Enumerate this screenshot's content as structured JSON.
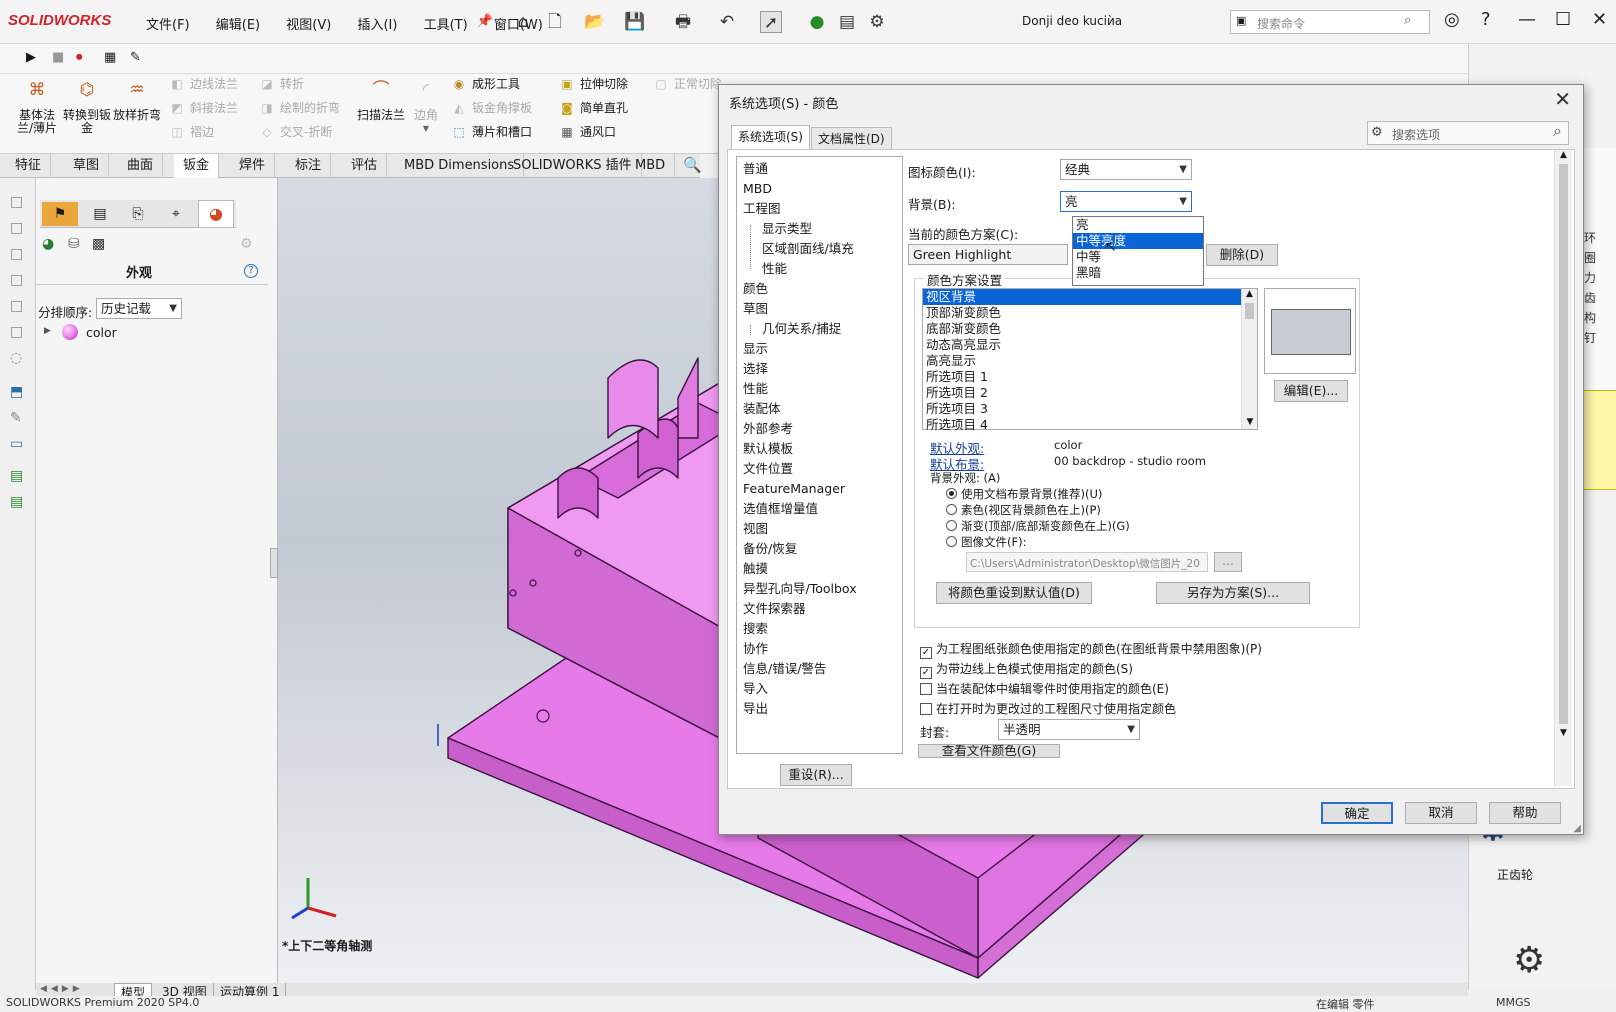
{
  "app": {
    "logo": "SOLIDWORKS",
    "menus": [
      "文件(F)",
      "编辑(E)",
      "视图(V)",
      "插入(I)",
      "工具(T)",
      "窗口(W)"
    ],
    "doc_title": "Donji deo kuciѝa",
    "search_placeholder": "搜索命令"
  },
  "ribbon": {
    "big_buttons": [
      "基体法兰/薄片",
      "转换到钣金",
      "放样折弯",
      "扫描法兰"
    ],
    "small_buttons": [
      {
        "label": "边线法兰",
        "disabled": true
      },
      {
        "label": "转折",
        "disabled": true
      },
      {
        "label": "斜接法兰",
        "disabled": true
      },
      {
        "label": "绘制的折弯",
        "disabled": true
      },
      {
        "label": "褶边",
        "disabled": true
      },
      {
        "label": "交叉-折断",
        "disabled": true
      },
      {
        "label": "边角",
        "disabled": true
      },
      {
        "label": "成形工具",
        "disabled": false
      },
      {
        "label": "钣金角撑板",
        "disabled": true
      },
      {
        "label": "薄片和槽口",
        "disabled": false
      },
      {
        "label": "拉伸切除",
        "disabled": false
      },
      {
        "label": "正常切除",
        "disabled": true
      },
      {
        "label": "简单直孔",
        "disabled": false
      },
      {
        "label": "通风口",
        "disabled": false
      }
    ]
  },
  "command_tabs": [
    "特征",
    "草图",
    "曲面",
    "钣金",
    "焊件",
    "标注",
    "评估",
    "MBD Dimensions",
    "SOLIDWORKS 插件",
    "MBD"
  ],
  "left_panel": {
    "title": "外观",
    "sort_label": "分排顺序:",
    "sort_value": "历史记载",
    "tree_item": "color"
  },
  "viewport": {
    "view_label": "*上下二等角轴测",
    "bottom_tabs": [
      "模型",
      "3D 视图",
      "运动算例 1"
    ],
    "status": "SOLIDWORKS Premium 2020 SP4.0",
    "status_right": "在编辑 零件",
    "units": "MMGS",
    "right_items": [
      "正齿轮"
    ]
  },
  "dialog": {
    "title": "系统选项(S) - 颜色",
    "tabs": [
      "系统选项(S)",
      "文档属性(D)"
    ],
    "search_placeholder": "搜索选项",
    "tree": [
      {
        "label": "普通",
        "sub": false
      },
      {
        "label": "MBD",
        "sub": false
      },
      {
        "label": "工程图",
        "sub": false
      },
      {
        "label": "显示类型",
        "sub": true
      },
      {
        "label": "区域剖面线/填充",
        "sub": true
      },
      {
        "label": "性能",
        "sub": true
      },
      {
        "label": "颜色",
        "sub": false
      },
      {
        "label": "草图",
        "sub": false
      },
      {
        "label": "几何关系/捕捉",
        "sub": true
      },
      {
        "label": "显示",
        "sub": false
      },
      {
        "label": "选择",
        "sub": false
      },
      {
        "label": "性能",
        "sub": false
      },
      {
        "label": "装配体",
        "sub": false
      },
      {
        "label": "外部参考",
        "sub": false
      },
      {
        "label": "默认模板",
        "sub": false
      },
      {
        "label": "文件位置",
        "sub": false
      },
      {
        "label": "FeatureManager",
        "sub": false
      },
      {
        "label": "选值框增量值",
        "sub": false
      },
      {
        "label": "视图",
        "sub": false
      },
      {
        "label": "备份/恢复",
        "sub": false
      },
      {
        "label": "触摸",
        "sub": false
      },
      {
        "label": "异型孔向导/Toolbox",
        "sub": false
      },
      {
        "label": "文件探索器",
        "sub": false
      },
      {
        "label": "搜索",
        "sub": false
      },
      {
        "label": "协作",
        "sub": false
      },
      {
        "label": "信息/错误/警告",
        "sub": false
      },
      {
        "label": "导入",
        "sub": false
      },
      {
        "label": "导出",
        "sub": false
      }
    ],
    "reset_button": "重设(R)...",
    "icon_color_label": "图标颜色(I):",
    "icon_color_value": "经典",
    "background_label": "背景(B):",
    "background_value": "亮",
    "background_options": [
      "亮",
      "中等亮度",
      "中等",
      "黑暗"
    ],
    "background_highlight_index": 1,
    "scheme_label": "当前的颜色方案(C):",
    "scheme_value": "Green Highlight",
    "delete_button": "删除(D)",
    "scheme_settings_title": "颜色方案设置",
    "scheme_items": [
      "视区背景",
      "顶部渐变颜色",
      "底部渐变颜色",
      "动态高亮显示",
      "高亮显示",
      "所选项目 1",
      "所选项目 2",
      "所选项目 3",
      "所选项目 4"
    ],
    "scheme_selected_index": 0,
    "swatch_color": "#c8ccd4",
    "edit_button": "编辑(E)...",
    "default_appearance_label": "默认外观:",
    "default_appearance_value": "color",
    "default_scene_label": "默认布景:",
    "default_scene_value": "00 backdrop - studio room",
    "bg_appearance_label": "背景外观: (A)",
    "radios": [
      {
        "label": "使用文档布景背景(推荐)(U)",
        "checked": true
      },
      {
        "label": "素色(视区背景颜色在上)(P)",
        "checked": false
      },
      {
        "label": "渐变(顶部/底部渐变颜色在上)(G)",
        "checked": false
      },
      {
        "label": "图像文件(F):",
        "checked": false
      }
    ],
    "image_path": "C:\\Users\\Administrator\\Desktop\\微信图片_20",
    "browse_button": "...",
    "reset_colors_button": "将颜色重设到默认值(D)",
    "save_scheme_button": "另存为方案(S)...",
    "checkboxes": [
      {
        "label": "为工程图纸张颜色使用指定的颜色(在图纸背景中禁用图象)(P)",
        "checked": true
      },
      {
        "label": "为带边线上色模式使用指定的颜色(S)",
        "checked": true
      },
      {
        "label": "当在装配体中编辑零件时使用指定的颜色(E)",
        "checked": false
      },
      {
        "label": "在打开时为更改过的工程图尺寸使用指定颜色",
        "checked": false
      }
    ],
    "envelope_label": "封套:",
    "envelope_value": "半透明",
    "view_doc_colors_button": "查看文件颜色(G)",
    "ok_button": "确定",
    "cancel_button": "取消",
    "help_button": "帮助"
  },
  "colors": {
    "model_pink": "#e77ae9",
    "model_edge": "#3a1440",
    "selection_blue": "#0a64d6",
    "primary_border": "#2b6fd6"
  }
}
